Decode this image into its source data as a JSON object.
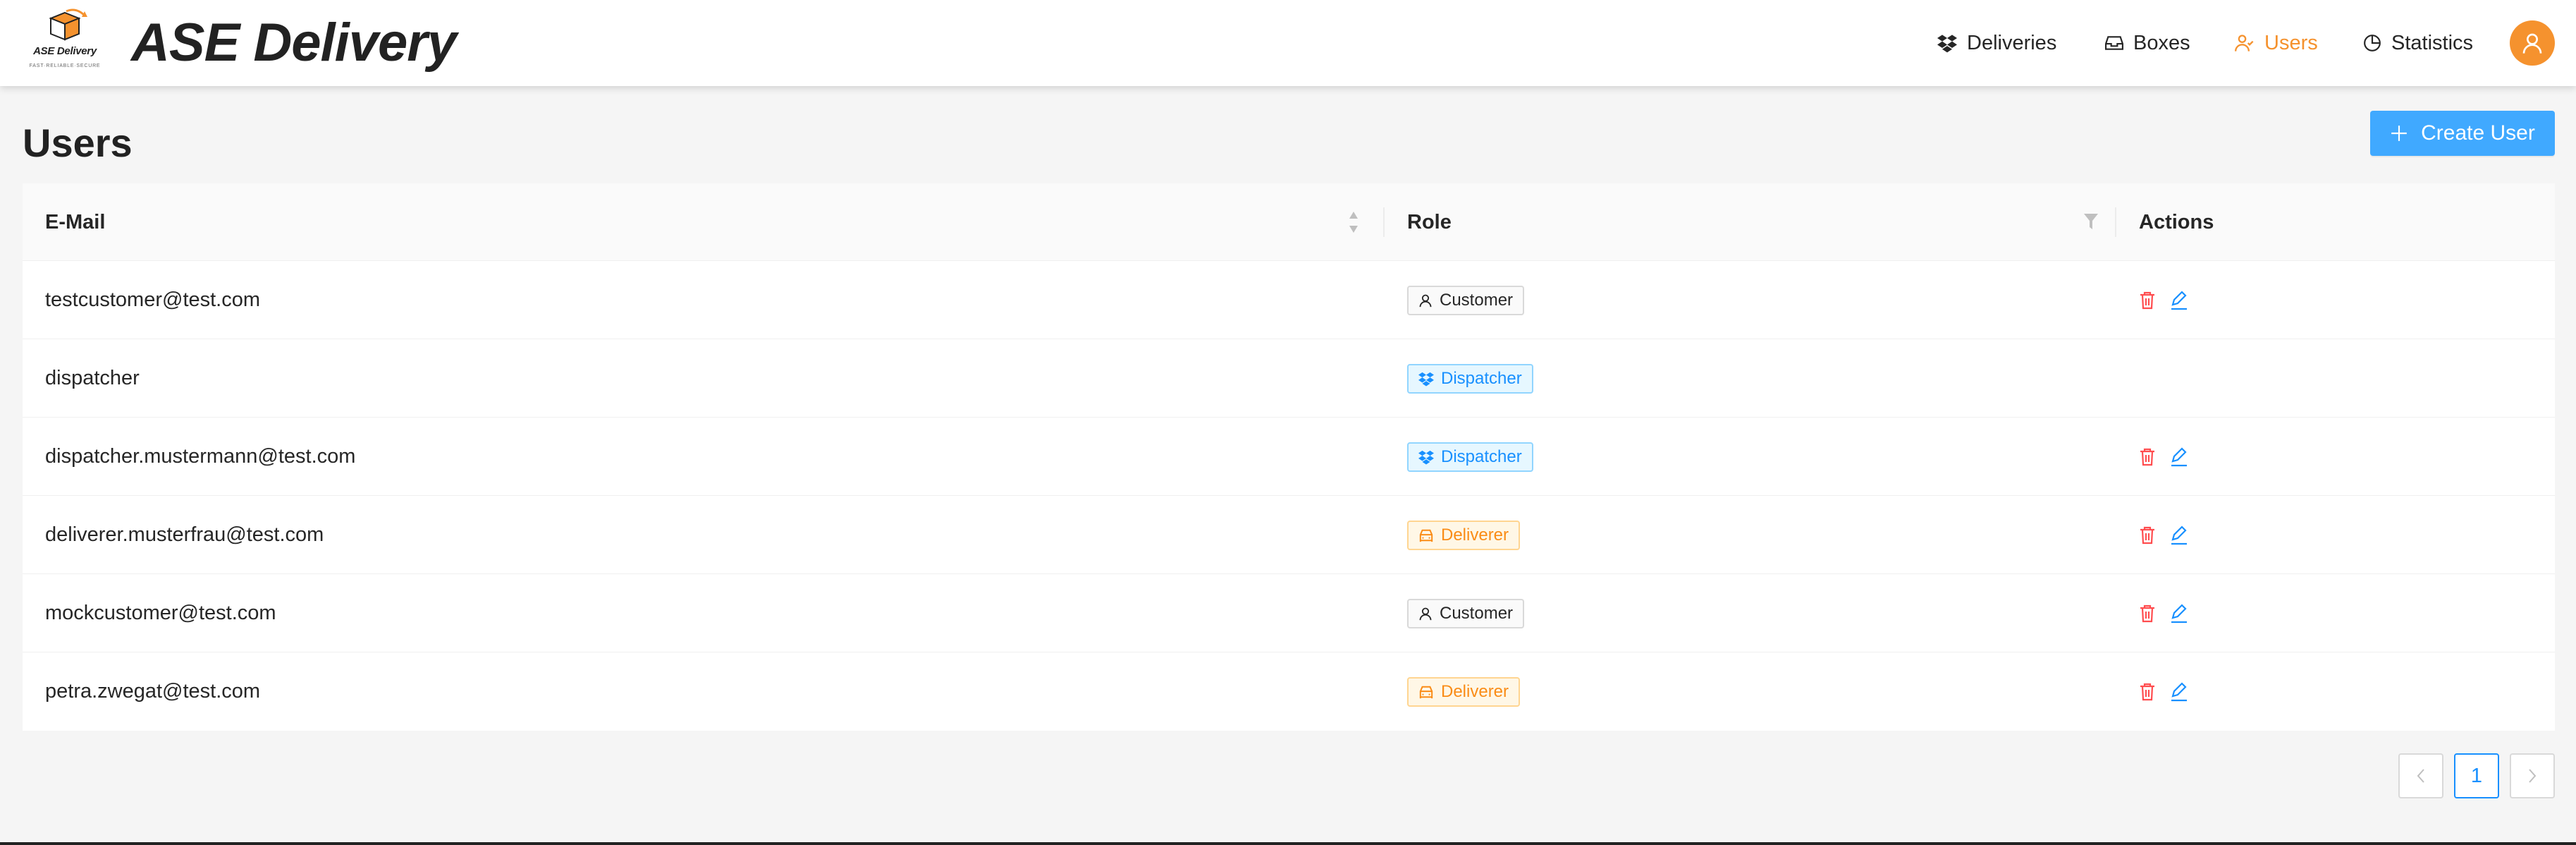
{
  "header": {
    "logo_text": "ASE Delivery",
    "logo_tagline": "FAST·RELIABLE·SECURE",
    "app_title": "ASE Delivery",
    "nav": [
      {
        "label": "Deliveries",
        "icon": "dropbox-icon",
        "active": false
      },
      {
        "label": "Boxes",
        "icon": "inbox-icon",
        "active": false
      },
      {
        "label": "Users",
        "icon": "users-icon",
        "active": true
      },
      {
        "label": "Statistics",
        "icon": "pie-chart-icon",
        "active": false
      }
    ],
    "avatar_icon": "user-icon"
  },
  "page": {
    "title": "Users",
    "create_button_label": "Create User"
  },
  "table": {
    "columns": {
      "email": "E-Mail",
      "role": "Role",
      "actions": "Actions"
    },
    "rows": [
      {
        "email": "testcustomer@test.com",
        "role": "Customer",
        "role_icon": "user-icon",
        "actions": true
      },
      {
        "email": "dispatcher",
        "role": "Dispatcher",
        "role_icon": "dropbox-icon",
        "actions": false
      },
      {
        "email": "dispatcher.mustermann@test.com",
        "role": "Dispatcher",
        "role_icon": "dropbox-icon",
        "actions": true
      },
      {
        "email": "deliverer.musterfrau@test.com",
        "role": "Deliverer",
        "role_icon": "car-icon",
        "actions": true
      },
      {
        "email": "mockcustomer@test.com",
        "role": "Customer",
        "role_icon": "user-icon",
        "actions": true
      },
      {
        "email": "petra.zwegat@test.com",
        "role": "Deliverer",
        "role_icon": "car-icon",
        "actions": true
      }
    ]
  },
  "pagination": {
    "prev": "<",
    "current_page": "1",
    "next": ">"
  },
  "colors": {
    "accent_orange": "#f5922e",
    "primary_blue": "#40a9ff",
    "delete_red": "#ff4d4f",
    "edit_blue": "#1890ff"
  }
}
